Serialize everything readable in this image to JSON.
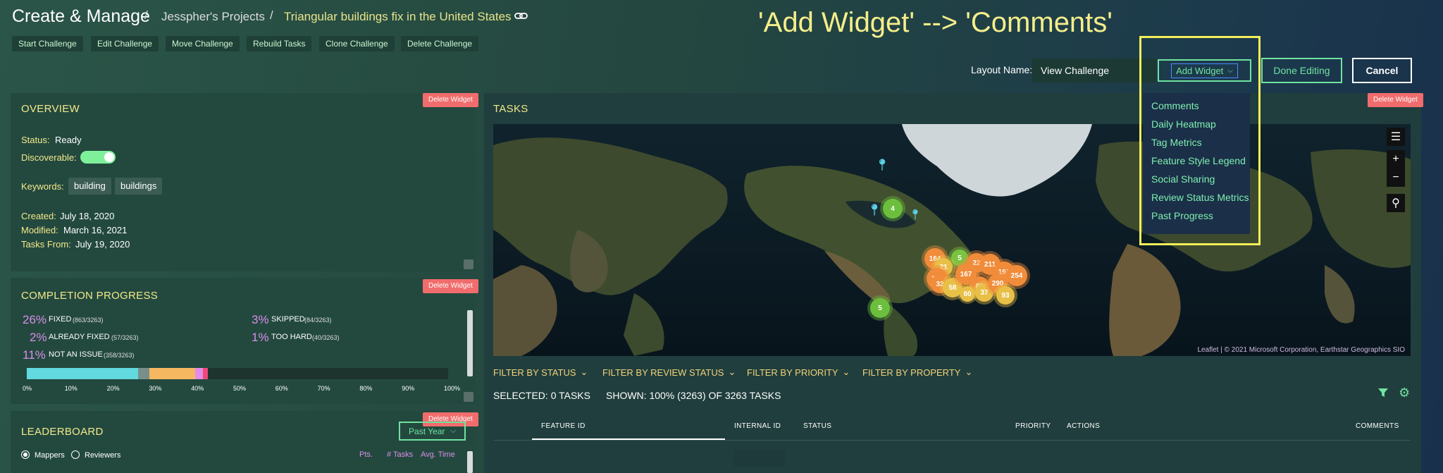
{
  "header": {
    "app_title": "Create & Manage",
    "sep": "/",
    "project": "Jesspher's Projects",
    "challenge": "Triangular buildings fix in the United States",
    "annotation": "'Add Widget' --> 'Comments'"
  },
  "toolbar": [
    "Start Challenge",
    "Edit Challenge",
    "Move Challenge",
    "Rebuild Tasks",
    "Clone Challenge",
    "Delete Challenge"
  ],
  "layout": {
    "label": "Layout Name:",
    "value": "View Challenge",
    "add_widget": "Add Widget",
    "done": "Done Editing",
    "cancel": "Cancel"
  },
  "add_widget_menu": [
    "Comments",
    "Daily Heatmap",
    "Tag Metrics",
    "Feature Style Legend",
    "Social Sharing",
    "Review Status Metrics",
    "Past Progress"
  ],
  "delete_widget": "Delete Widget",
  "overview": {
    "title": "OVERVIEW",
    "status_label": "Status:",
    "status": "Ready",
    "discoverable_label": "Discoverable:",
    "discoverable": true,
    "keywords_label": "Keywords:",
    "keywords": [
      "building",
      "buildings"
    ],
    "created_label": "Created:",
    "created": "July 18, 2020",
    "modified_label": "Modified:",
    "modified": "March 16, 2021",
    "tasks_from_label": "Tasks From:",
    "tasks_from": "July 19, 2020"
  },
  "completion": {
    "title": "COMPLETION PROGRESS",
    "items": [
      {
        "pct": "26%",
        "label": "FIXED",
        "count": "(863/3263)"
      },
      {
        "pct": "3%",
        "label": "SKIPPED",
        "count": "(84/3263)"
      },
      {
        "pct": "2%",
        "label": "ALREADY FIXED",
        "count": "(57/3263)"
      },
      {
        "pct": "1%",
        "label": "TOO HARD",
        "count": "(40/3263)"
      },
      {
        "pct": "11%",
        "label": "NOT AN ISSUE",
        "count": "(358/3263)"
      }
    ],
    "ticks": [
      "0%",
      "10%",
      "20%",
      "30%",
      "40%",
      "50%",
      "60%",
      "70%",
      "80%",
      "90%",
      "100%"
    ],
    "bar_colors": {
      "fixed": "#62d8df",
      "skipped": "#7a8f8a",
      "not_an_issue": "#f5b861",
      "already_fixed": "#e28ce8",
      "too_hard": "#f0477a",
      "remaining": "#1d332e"
    }
  },
  "leaderboard": {
    "title": "LEADERBOARD",
    "period": "Past Year",
    "mappers": "Mappers",
    "reviewers": "Reviewers",
    "cols": [
      "Pts.",
      "# Tasks",
      "Avg. Time"
    ]
  },
  "tasks": {
    "title": "TASKS",
    "filters": [
      "FILTER BY STATUS",
      "FILTER BY REVIEW STATUS",
      "FILTER BY PRIORITY",
      "FILTER BY PROPERTY"
    ],
    "selected": "SELECTED: 0 TASKS",
    "shown": "SHOWN: 100% (3263) OF 3263 TASKS",
    "columns": [
      "FEATURE ID",
      "INTERNAL ID",
      "STATUS",
      "PRIORITY",
      "ACTIONS",
      "COMMENTS"
    ],
    "attribution": "Leaflet | © 2021 Microsoft Corporation, Earthstar Geographics SIO",
    "clusters": [
      "164",
      "5",
      "21",
      "22",
      "211",
      "197",
      "254",
      "140",
      "32",
      "58",
      "167",
      "88",
      "37",
      "290",
      "93",
      "4",
      "5",
      "60"
    ]
  }
}
